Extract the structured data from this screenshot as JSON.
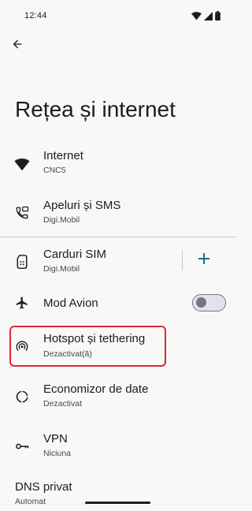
{
  "status_bar": {
    "time": "12:44",
    "icons": [
      "wifi-icon",
      "signal-icon",
      "battery-icon"
    ]
  },
  "header": {
    "title": "Rețea și internet"
  },
  "items": [
    {
      "title": "Internet",
      "subtitle": "CNC5",
      "icon": "wifi-icon"
    },
    {
      "title": "Apeluri și SMS",
      "subtitle": "Digi.Mobil",
      "icon": "call-sms-icon"
    },
    {
      "title": "Carduri SIM",
      "subtitle": "Digi.Mobil",
      "icon": "sim-card-icon"
    },
    {
      "title": "Mod Avion",
      "icon": "airplane-icon",
      "toggle": false
    },
    {
      "title": "Hotspot și tethering",
      "subtitle": "Dezactivat(ă)",
      "icon": "hotspot-icon"
    },
    {
      "title": "Economizor de date",
      "subtitle": "Dezactivat",
      "icon": "data-saver-icon"
    },
    {
      "title": "VPN",
      "subtitle": "Niciuna",
      "icon": "vpn-key-icon"
    }
  ],
  "dns": {
    "title": "DNS privat",
    "subtitle": "Automat"
  },
  "colors": {
    "background": "#f8f8f8",
    "highlight": "#e3262f",
    "accent": "#1a6b8f"
  }
}
